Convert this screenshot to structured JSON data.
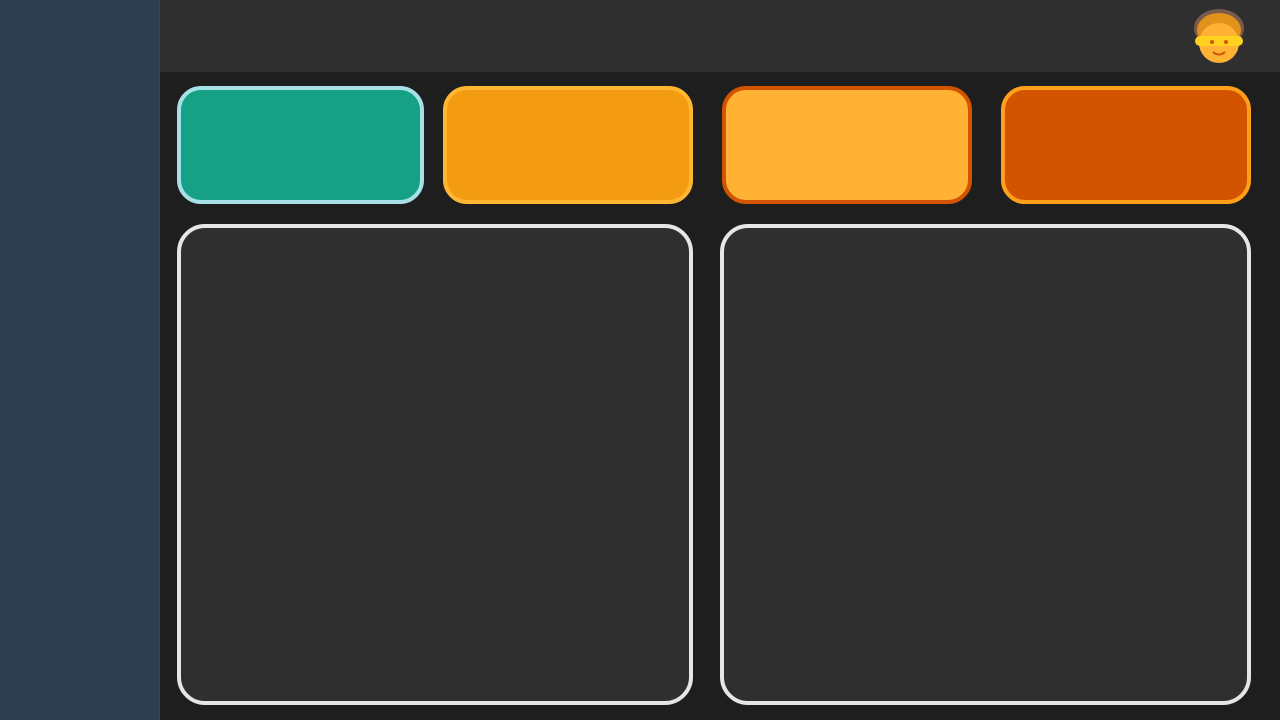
{
  "colors": {
    "sidebar": "#2c3e50",
    "topbar": "#2f2f2f",
    "background": "#1e1e1e",
    "card_teal": "#16a085",
    "card_amber": "#f39c12",
    "card_yellow": "#ffb234",
    "card_orange": "#d35400",
    "panel_border": "#e6e6e6"
  },
  "topbar": {
    "avatar_icon": "user-avatar-icon"
  },
  "stat_cards": [
    {
      "color": "teal"
    },
    {
      "color": "amber"
    },
    {
      "color": "yellow"
    },
    {
      "color": "orange"
    }
  ],
  "panels": [
    {
      "position": "left"
    },
    {
      "position": "right"
    }
  ]
}
